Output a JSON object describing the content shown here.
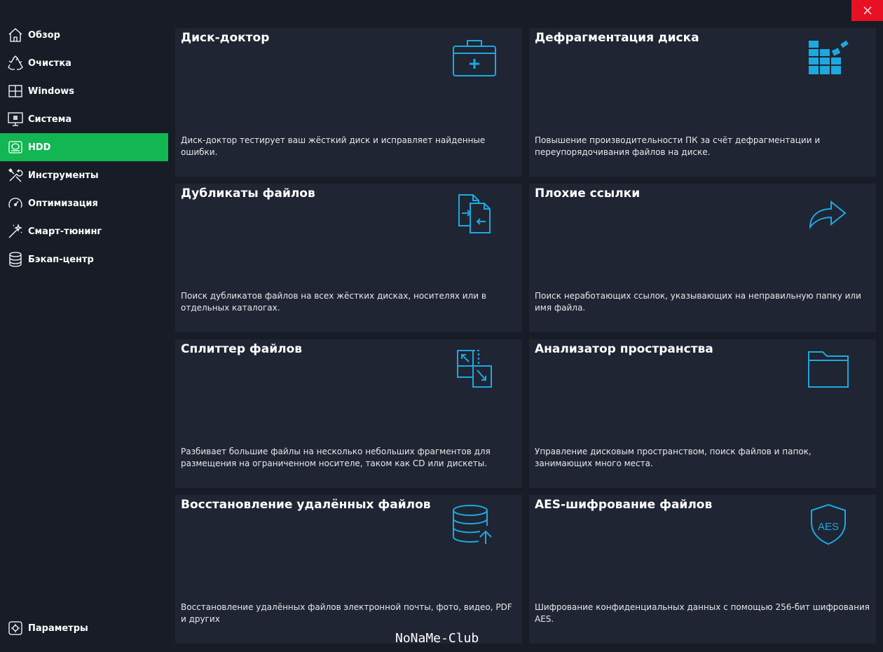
{
  "window": {
    "close_label": ""
  },
  "sidebar": {
    "items": [
      {
        "label": "Обзор",
        "icon": "home-icon"
      },
      {
        "label": "Очистка",
        "icon": "recycle-icon"
      },
      {
        "label": "Windows",
        "icon": "windows-icon"
      },
      {
        "label": "Система",
        "icon": "monitor-icon"
      },
      {
        "label": "HDD",
        "icon": "hdd-icon",
        "active": true
      },
      {
        "label": "Инструменты",
        "icon": "tools-icon"
      },
      {
        "label": "Оптимизация",
        "icon": "speedometer-icon"
      },
      {
        "label": "Смарт-тюнинг",
        "icon": "magic-wand-icon"
      },
      {
        "label": "Бэкап-центр",
        "icon": "database-icon"
      }
    ],
    "settings_label": "Параметры"
  },
  "cards": [
    {
      "title": "Диск-доктор",
      "description": "Диск-доктор тестирует ваш жёсткий диск и исправляет найденные ошибки.",
      "icon": "medical-kit-icon"
    },
    {
      "title": "Дефрагментация диска",
      "description": "Повышение производительности ПК за счёт дефрагментации и переупорядочивания файлов на диске.",
      "icon": "defrag-blocks-icon"
    },
    {
      "title": "Дубликаты файлов",
      "description": "Поиск дубликатов файлов на всех жёстких дисках, носителях или в отдельных каталогах.",
      "icon": "duplicate-files-icon"
    },
    {
      "title": "Плохие ссылки",
      "description": "Поиск неработающих ссылок, указывающих на неправильную папку или имя файла.",
      "icon": "redirect-arrow-icon"
    },
    {
      "title": "Сплиттер файлов",
      "description": "Разбивает большие файлы на несколько небольших фрагментов для размещения на ограниченном носителе, таком как CD или дискеты.",
      "icon": "split-file-icon"
    },
    {
      "title": "Анализатор пространства",
      "description": "Управление дисковым пространством, поиск файлов и папок, занимающих много места.",
      "icon": "folder-icon"
    },
    {
      "title": "Восстановление удалённых файлов",
      "description": "Восстановление удалённых файлов электронной почты, фото, видео, PDF и других",
      "icon": "database-restore-icon"
    },
    {
      "title": "AES-шифрование файлов",
      "description": "Шифрование конфиденциальных данных с помощью 256-бит шифрования AES.",
      "icon": "aes-shield-icon",
      "icon_text": "AES"
    }
  ],
  "watermark": "NoNaMe-Club",
  "colors": {
    "accent": "#1ea8e0",
    "active_nav": "#12b652",
    "close": "#e81123",
    "card_bg": "#1f2533",
    "bg": "#171c26"
  }
}
